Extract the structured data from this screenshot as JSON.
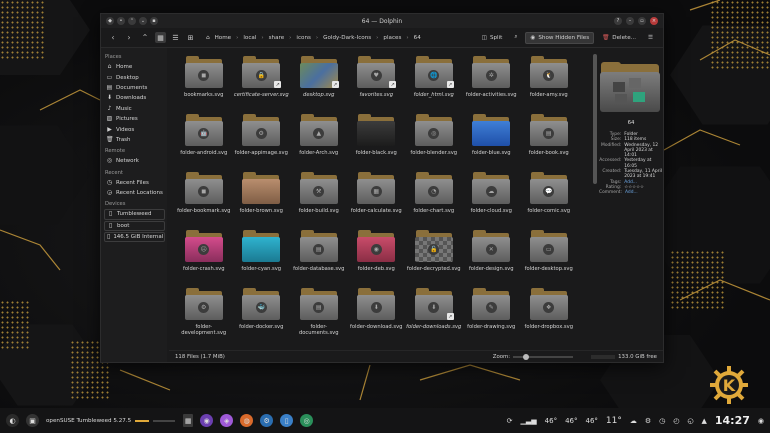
{
  "window": {
    "title": "64 — Dolphin"
  },
  "toolbar": {
    "split_label": "Split",
    "show_hidden_label": "Show Hidden Files",
    "delete_label": "Delete...",
    "breadcrumbs": [
      "Home",
      "local",
      "share",
      "icons",
      "Goldy-Dark-Icons",
      "places",
      "64"
    ]
  },
  "sidebar": {
    "places_head": "Places",
    "places": [
      {
        "label": "Home",
        "icon": "home-icon"
      },
      {
        "label": "Desktop",
        "icon": "desktop-icon"
      },
      {
        "label": "Documents",
        "icon": "documents-icon"
      },
      {
        "label": "Downloads",
        "icon": "downloads-icon"
      },
      {
        "label": "Music",
        "icon": "music-icon"
      },
      {
        "label": "Pictures",
        "icon": "pictures-icon"
      },
      {
        "label": "Videos",
        "icon": "videos-icon"
      },
      {
        "label": "Trash",
        "icon": "trash-icon"
      }
    ],
    "remote_head": "Remote",
    "remote": [
      {
        "label": "Network",
        "icon": "network-icon"
      }
    ],
    "recent_head": "Recent",
    "recent": [
      {
        "label": "Recent Files",
        "icon": "recent-files-icon"
      },
      {
        "label": "Recent Locations",
        "icon": "recent-locations-icon"
      }
    ],
    "devices_head": "Devices",
    "devices": [
      {
        "label": "Tumbleweed",
        "icon": "drive-icon"
      },
      {
        "label": "boot",
        "icon": "drive-icon"
      },
      {
        "label": "146.5 GiB Internal ...",
        "icon": "drive-icon"
      }
    ]
  },
  "files": [
    {
      "name": "bookmarks.svg",
      "emb": "◼",
      "italic": false
    },
    {
      "name": "certificate-server.svg",
      "emb": "🔒",
      "italic": true,
      "link": true
    },
    {
      "name": "desktop.svg",
      "emb": "",
      "italic": true,
      "link": true,
      "style": "desk"
    },
    {
      "name": "favorites.svg",
      "emb": "♥",
      "italic": true,
      "link": true
    },
    {
      "name": "folder_html.svg",
      "emb": "🌐",
      "italic": true,
      "link": true
    },
    {
      "name": "folder-activities.svg",
      "emb": "✲",
      "italic": false
    },
    {
      "name": "folder-amy.svg",
      "emb": "🐧",
      "italic": false,
      "style": "amy"
    },
    {
      "name": "folder-android.svg",
      "emb": "🤖",
      "italic": false
    },
    {
      "name": "folder-appimage.svg",
      "emb": "⚙",
      "italic": false
    },
    {
      "name": "folder-Arch.svg",
      "emb": "▲",
      "italic": false
    },
    {
      "name": "folder-black.svg",
      "emb": "",
      "italic": false,
      "style": "black"
    },
    {
      "name": "folder-blender.svg",
      "emb": "◎",
      "italic": false
    },
    {
      "name": "folder-blue.svg",
      "emb": "",
      "italic": false,
      "style": "blue"
    },
    {
      "name": "folder-book.svg",
      "emb": "▤",
      "italic": false
    },
    {
      "name": "folder-bookmark.svg",
      "emb": "◼",
      "italic": false
    },
    {
      "name": "folder-brown.svg",
      "emb": "",
      "italic": false,
      "style": "brown"
    },
    {
      "name": "folder-build.svg",
      "emb": "⚒",
      "italic": false
    },
    {
      "name": "folder-calculate.svg",
      "emb": "▦",
      "italic": false
    },
    {
      "name": "folder-chart.svg",
      "emb": "◔",
      "italic": false
    },
    {
      "name": "folder-cloud.svg",
      "emb": "☁",
      "italic": false
    },
    {
      "name": "folder-comic.svg",
      "emb": "💬",
      "italic": false
    },
    {
      "name": "folder-crash.svg",
      "emb": "☹",
      "italic": false,
      "style": "pink"
    },
    {
      "name": "folder-cyan.svg",
      "emb": "",
      "italic": false,
      "style": "cyan"
    },
    {
      "name": "folder-database.svg",
      "emb": "▤",
      "italic": false
    },
    {
      "name": "folder-deb.svg",
      "emb": "◉",
      "italic": false,
      "style": "red"
    },
    {
      "name": "folder-decrypted.svg",
      "emb": "🔓",
      "italic": false,
      "style": "check"
    },
    {
      "name": "folder-design.svg",
      "emb": "✕",
      "italic": false
    },
    {
      "name": "folder-desktop.svg",
      "emb": "▭",
      "italic": false
    },
    {
      "name": "folder-development.svg",
      "emb": "⚙",
      "italic": false
    },
    {
      "name": "folder-docker.svg",
      "emb": "🐳",
      "italic": false
    },
    {
      "name": "folder-documents.svg",
      "emb": "▤",
      "italic": false
    },
    {
      "name": "folder-download.svg",
      "emb": "⬇",
      "italic": false
    },
    {
      "name": "folder-downloads.svg",
      "emb": "⬇",
      "italic": true,
      "link": true
    },
    {
      "name": "folder-drawing.svg",
      "emb": "✎",
      "italic": false
    },
    {
      "name": "folder-dropbox.svg",
      "emb": "❖",
      "italic": false
    }
  ],
  "info_panel": {
    "name": "64",
    "rows": [
      {
        "k": "Type:",
        "v": "Folder"
      },
      {
        "k": "Size:",
        "v": "118 items"
      },
      {
        "k": "Modified:",
        "v": "Wednesday, 12 April 2023 at 14:01"
      },
      {
        "k": "Accessed:",
        "v": "Yesterday at 16:05"
      },
      {
        "k": "Created:",
        "v": "Tuesday, 11 April 2023 at 19:41"
      },
      {
        "k": "Tags:",
        "v": "Add...",
        "link": true
      },
      {
        "k": "Rating:",
        "v": "☆☆☆☆☆"
      },
      {
        "k": "Comment:",
        "v": "Add...",
        "link": true
      }
    ]
  },
  "statusbar": {
    "count": "118 Files (1.7 MiB)",
    "zoom_label": "Zoom:",
    "free": "133.0 GiB free"
  },
  "taskbar": {
    "window_label": "openSUSE Tumbleweed 5.27.5",
    "temps": [
      "46°",
      "46°",
      "46°"
    ],
    "weather": "11°",
    "clock": "14:27"
  }
}
